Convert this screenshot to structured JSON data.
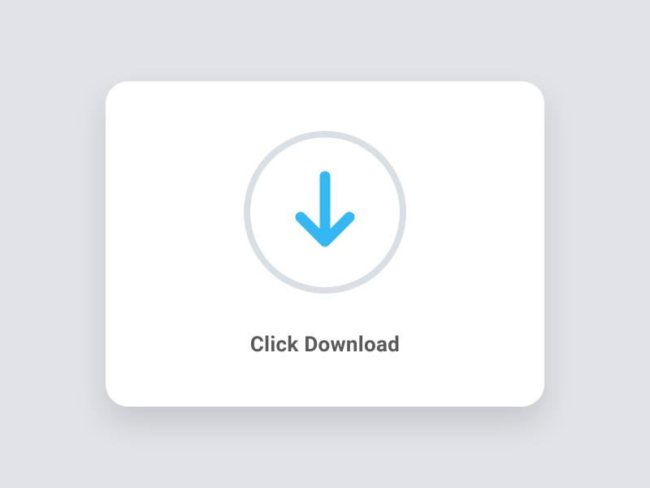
{
  "download": {
    "label": "Click Download",
    "icon_name": "download-arrow-icon",
    "colors": {
      "background": "#e1e3e8",
      "card": "#ffffff",
      "circle_border": "#d8dfe5",
      "arrow": "#33b8f4",
      "text": "#5a5a5a"
    }
  }
}
